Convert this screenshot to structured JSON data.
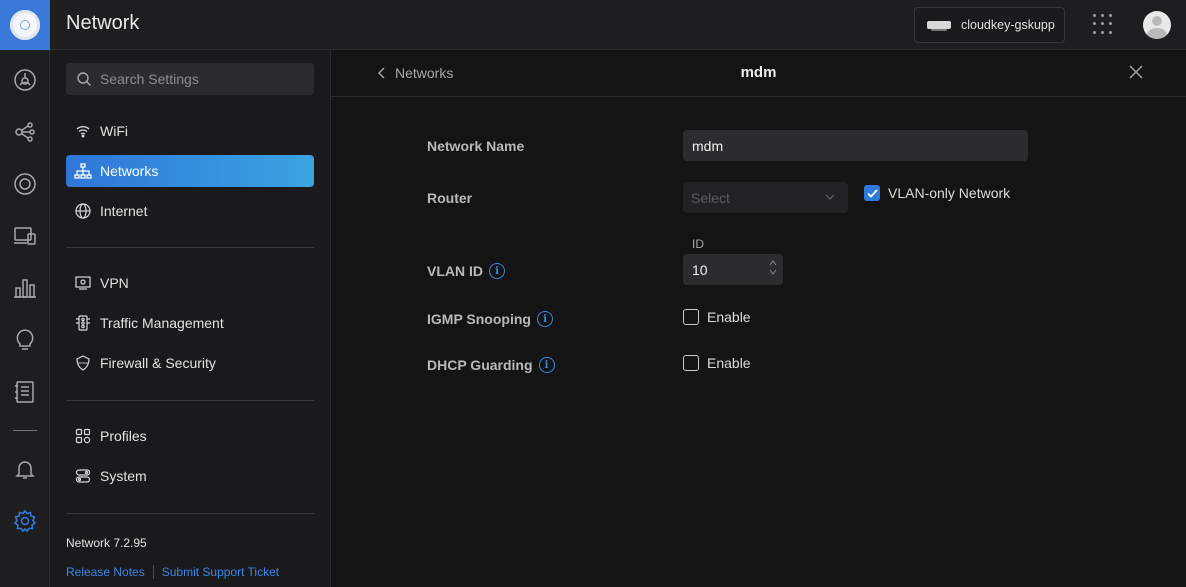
{
  "header": {
    "app_title": "Network",
    "device_name": "cloudkey-gskupp"
  },
  "rail": {
    "icons": [
      "dashboard-icon",
      "topology-icon",
      "devices-icon",
      "clients-icon",
      "statistics-icon",
      "insights-icon",
      "logs-icon",
      "alerts-icon",
      "settings-icon"
    ],
    "active": "settings-icon",
    "accent_color": "#2f7bdc"
  },
  "sidebar": {
    "search_placeholder": "Search Settings",
    "items": [
      {
        "label": "WiFi",
        "icon": "wifi-icon"
      },
      {
        "label": "Networks",
        "icon": "networks-icon",
        "active": true
      },
      {
        "label": "Internet",
        "icon": "globe-icon"
      },
      {
        "label": "VPN",
        "icon": "vpn-icon"
      },
      {
        "label": "Traffic Management",
        "icon": "traffic-icon"
      },
      {
        "label": "Firewall & Security",
        "icon": "shield-icon"
      },
      {
        "label": "Profiles",
        "icon": "profiles-icon"
      },
      {
        "label": "System",
        "icon": "system-icon"
      }
    ],
    "version": "Network 7.2.95",
    "release_notes": "Release Notes",
    "support_ticket": "Submit Support Ticket"
  },
  "panel": {
    "back_label": "Networks",
    "title": "mdm"
  },
  "form": {
    "network_name_label": "Network Name",
    "network_name_value": "mdm",
    "router_label": "Router",
    "router_placeholder": "Select",
    "vlan_only_label": "VLAN-only Network",
    "vlan_only_checked": true,
    "vlan_id_label": "VLAN ID",
    "id_caption": "ID",
    "vlan_id_value": "10",
    "igmp_label": "IGMP Snooping",
    "igmp_enable_label": "Enable",
    "igmp_checked": false,
    "dhcp_label": "DHCP Guarding",
    "dhcp_enable_label": "Enable",
    "dhcp_checked": false
  }
}
